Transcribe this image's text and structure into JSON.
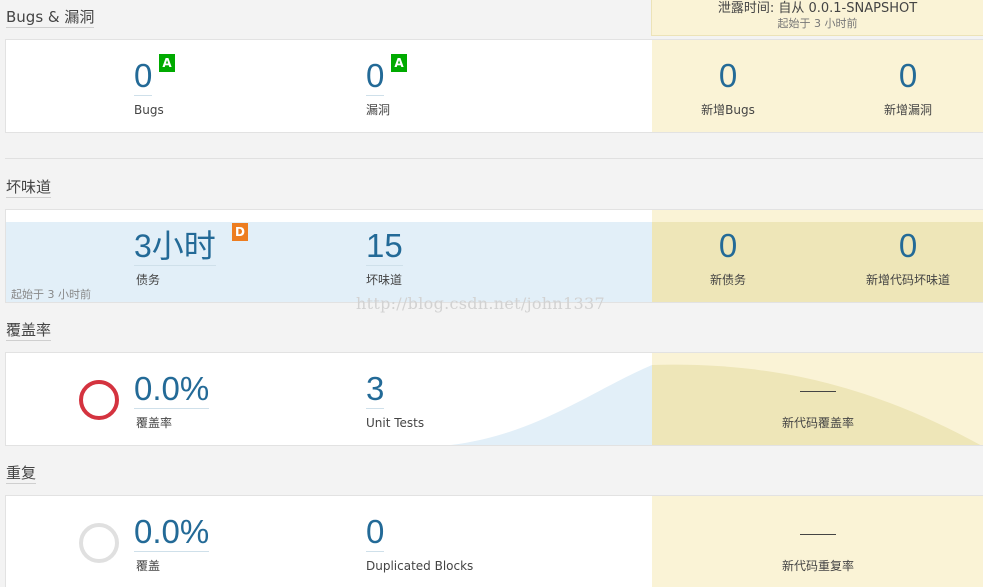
{
  "leak_header": {
    "title": "泄露时间: 自从 0.0.1-SNAPSHOT",
    "subtitle": "起始于 3 小时前"
  },
  "bugs": {
    "title": "Bugs & 漏洞",
    "bugs_value": "0",
    "bugs_label": "Bugs",
    "bugs_rating": "A",
    "vuln_value": "0",
    "vuln_label": "漏洞",
    "vuln_rating": "A",
    "new_bugs_value": "0",
    "new_bugs_label": "新增Bugs",
    "new_vuln_value": "0",
    "new_vuln_label": "新增漏洞"
  },
  "smells": {
    "title": "坏味道",
    "debt_value": "3小时",
    "debt_label": "债务",
    "debt_rating": "D",
    "smells_value": "15",
    "smells_label": "坏味道",
    "since": "起始于 3 小时前",
    "new_debt_value": "0",
    "new_debt_label": "新债务",
    "new_smells_value": "0",
    "new_smells_label": "新增代码坏味道"
  },
  "watermark": "http://blog.csdn.net/john1337",
  "coverage": {
    "title": "覆盖率",
    "coverage_value": "0.0%",
    "coverage_label": "覆盖率",
    "tests_value": "3",
    "tests_label": "Unit Tests",
    "new_coverage_label": "新代码覆盖率"
  },
  "duplications": {
    "title": "重复",
    "dup_value": "0.0%",
    "dup_label": "覆盖",
    "blocks_value": "0",
    "blocks_label": "Duplicated Blocks",
    "new_dup_label": "新代码重复率"
  },
  "colors": {
    "accent": "#236a97",
    "rating_a": "#00aa00",
    "rating_d": "#ed7d20",
    "leak_bg": "#faf3d6",
    "coverage_ring": "#d4333f"
  }
}
